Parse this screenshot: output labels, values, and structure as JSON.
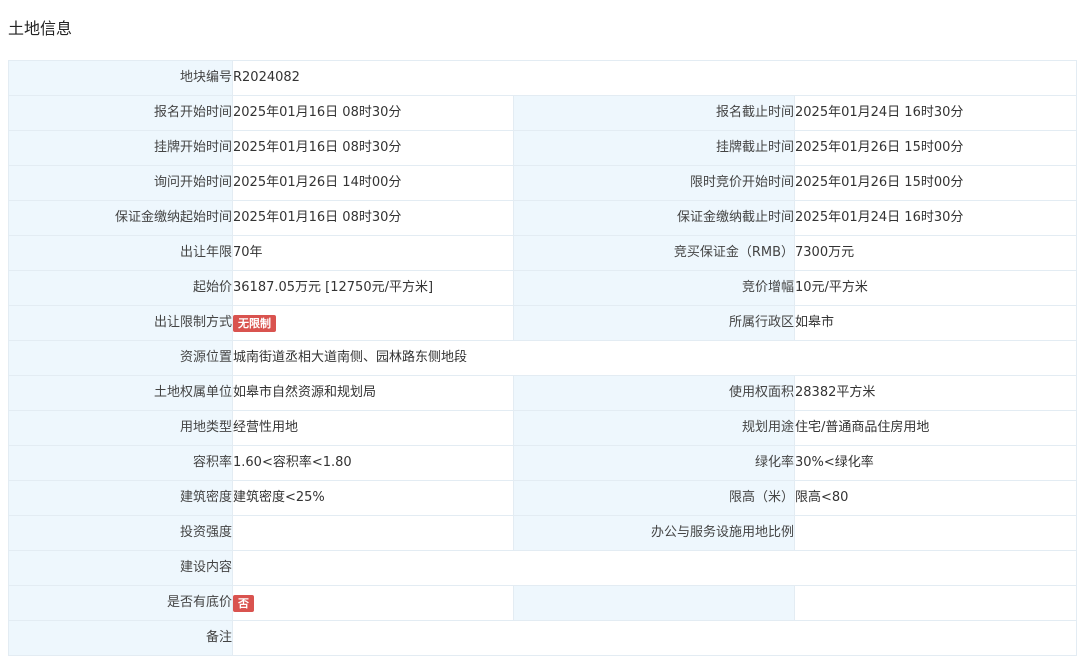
{
  "section": {
    "title": "土地信息"
  },
  "fields": {
    "parcel_no": {
      "label": "地块编号",
      "value": "R2024082"
    },
    "reg_start": {
      "label": "报名开始时间",
      "value": "2025年01月16日 08时30分"
    },
    "reg_end": {
      "label": "报名截止时间",
      "value": "2025年01月24日 16时30分"
    },
    "listing_start": {
      "label": "挂牌开始时间",
      "value": "2025年01月16日 08时30分"
    },
    "listing_end": {
      "label": "挂牌截止时间",
      "value": "2025年01月26日 15时00分"
    },
    "inquiry_start": {
      "label": "询问开始时间",
      "value": "2025年01月26日 14时00分"
    },
    "timed_bid_start": {
      "label": "限时竞价开始时间",
      "value": "2025年01月26日 15时00分"
    },
    "deposit_start": {
      "label": "保证金缴纳起始时间",
      "value": "2025年01月16日 08时30分"
    },
    "deposit_end": {
      "label": "保证金缴纳截止时间",
      "value": "2025年01月24日 16时30分"
    },
    "term": {
      "label": "出让年限",
      "value": "70年"
    },
    "bid_deposit": {
      "label": "竞买保证金（RMB）",
      "value": "7300万元"
    },
    "start_price": {
      "label": "起始价",
      "value": "36187.05万元 [12750元/平方米]"
    },
    "increment": {
      "label": "竞价增幅",
      "value": "10元/平方米"
    },
    "restriction": {
      "label": "出让限制方式",
      "badge": "无限制"
    },
    "district": {
      "label": "所属行政区",
      "value": "如皋市"
    },
    "location": {
      "label": "资源位置",
      "value": "城南街道丞相大道南侧、园林路东侧地段"
    },
    "owner": {
      "label": "土地权属单位",
      "value": "如皋市自然资源和规划局"
    },
    "area": {
      "label": "使用权面积",
      "value": "28382平方米"
    },
    "land_type": {
      "label": "用地类型",
      "value": "经营性用地"
    },
    "planned_use": {
      "label": "规划用途",
      "value": "住宅/普通商品住房用地"
    },
    "far": {
      "label": "容积率",
      "value": "1.60<容积率<1.80"
    },
    "green": {
      "label": "绿化率",
      "value": "30%<绿化率"
    },
    "density": {
      "label": "建筑密度",
      "value": "建筑密度<25%"
    },
    "height": {
      "label": "限高（米）",
      "value": "限高<80"
    },
    "investment": {
      "label": "投资强度",
      "value": ""
    },
    "office_ratio": {
      "label": "办公与服务设施用地比例",
      "value": ""
    },
    "construction": {
      "label": "建设内容",
      "value": ""
    },
    "reserve_price": {
      "label": "是否有底价",
      "badge": "否"
    },
    "remarks": {
      "label": "备注",
      "value": ""
    }
  },
  "colors": {
    "label_bg": "#eef7fd",
    "border": "#e3ecf3",
    "badge": "#d9534f"
  }
}
